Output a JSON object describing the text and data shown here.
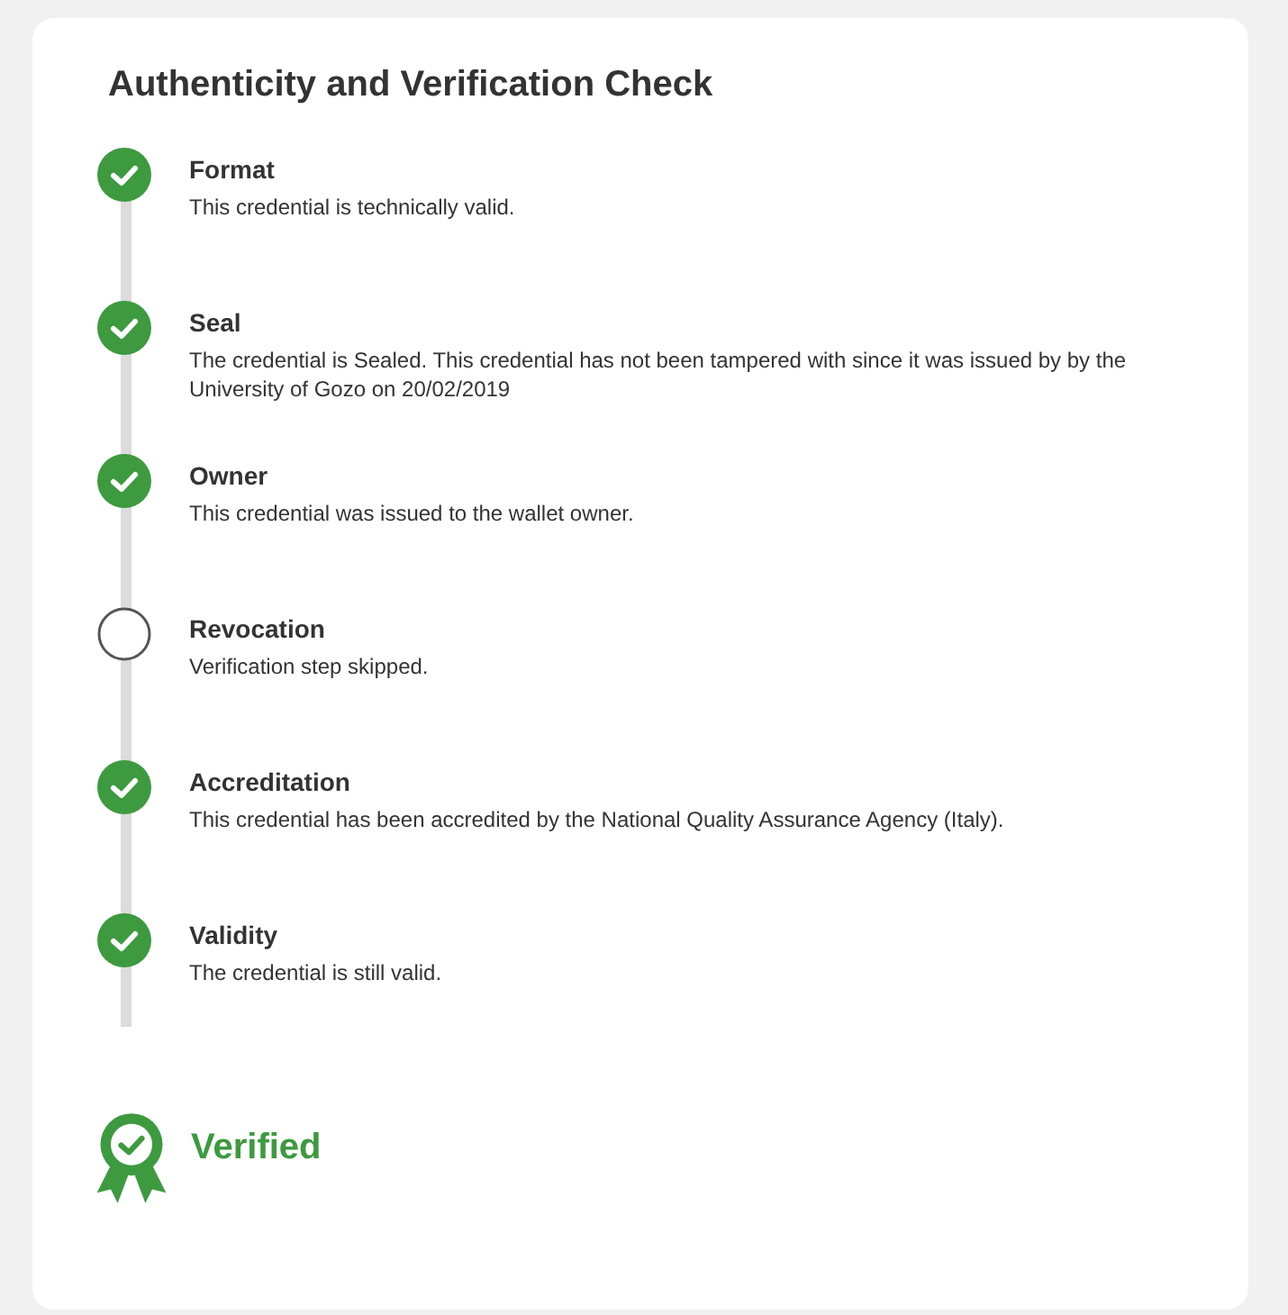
{
  "title": "Authenticity and Verification Check",
  "steps": [
    {
      "name": "Format",
      "description": "This credential is technically valid.",
      "passed": true
    },
    {
      "name": "Seal",
      "description": "The credential is Sealed. This credential has not been tampered with since it was issued by by the University of Gozo on 20/02/2019",
      "passed": true
    },
    {
      "name": "Owner",
      "description": "This credential was issued to the wallet owner.",
      "passed": true
    },
    {
      "name": "Revocation",
      "description": "Verification step skipped.",
      "passed": false
    },
    {
      "name": "Accreditation",
      "description": "This credential has been accredited by the National Quality Assurance Agency (Italy).",
      "passed": true
    },
    {
      "name": "Validity",
      "description": "The credential is still valid.",
      "passed": true
    }
  ],
  "result": {
    "label": "Verified",
    "verified": true
  }
}
